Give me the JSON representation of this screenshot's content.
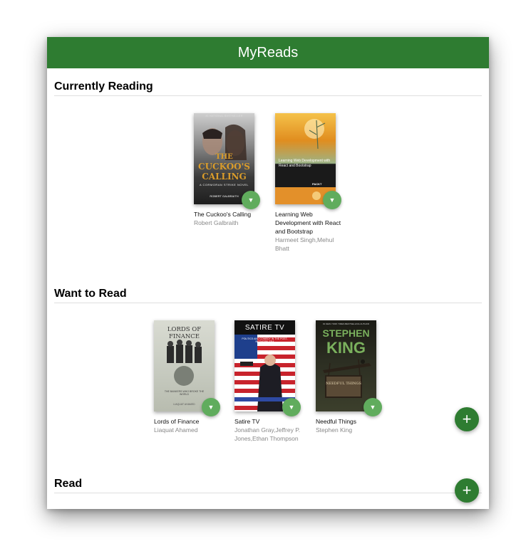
{
  "app": {
    "title": "MyReads"
  },
  "icons": {
    "changer": "chevron-down-icon",
    "add": "plus-icon"
  },
  "colors": {
    "header": "#2e7c31",
    "changer": "#60ac5d",
    "fab": "#2e7c31"
  },
  "shelves": [
    {
      "title": "Currently Reading",
      "books": [
        {
          "title": "The Cuckoo's Calling",
          "authors": "Robert Galbraith",
          "cover": {
            "banner": "#1 NATIONAL BESTSELLER",
            "line1": "THE",
            "line2": "CUCKOO'S",
            "line3": "CALLING",
            "subtitle": "A CORMORAN STRIKE NOVEL",
            "author": "ROBERT GALBRAITH"
          }
        },
        {
          "title": "Learning Web Development with React and Bootstrap",
          "authors": "Harmeet Singh,Mehul Bhatt",
          "cover": {
            "title": "Learning Web Development with React and Bootstrap",
            "publisher": "PACKT"
          }
        }
      ]
    },
    {
      "title": "Want to Read",
      "books": [
        {
          "title": "Lords of Finance",
          "authors": "Liaquat Ahamed",
          "cover": {
            "title": "LORDS OF FINANCE",
            "subtitle": "THE BANKERS WHO BROKE THE WORLD",
            "author": "LIAQUAT AHAMED"
          }
        },
        {
          "title": "Satire TV",
          "authors": "Jonathan Gray,Jeffrey P. Jones,Ethan Thompson",
          "cover": {
            "title": "SATIRE TV",
            "subtitle": "POLITICS AND COMEDY IN THE POST-NETWORK ERA"
          }
        },
        {
          "title": "Needful Things",
          "authors": "Stephen King",
          "cover": {
            "banner": "#1 NEW YORK TIMES BESTSELLING AUTHOR",
            "line1": "STEPHEN",
            "line2": "KING",
            "sign": "NEEDFUL THINGS"
          }
        }
      ]
    },
    {
      "title": "Read",
      "books": []
    }
  ]
}
